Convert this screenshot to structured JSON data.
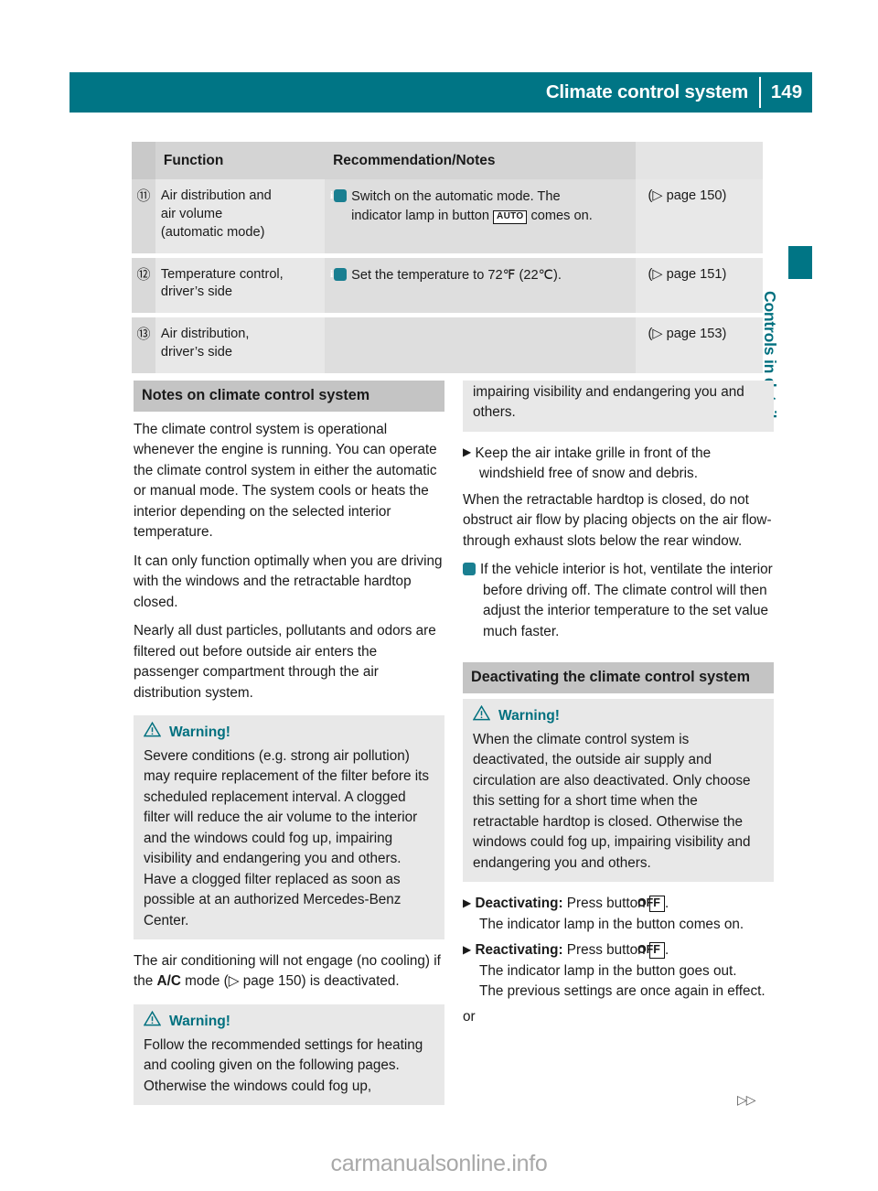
{
  "header": {
    "title": "Climate control system",
    "page_number": "149"
  },
  "side_tab": {
    "label": "Controls in detail"
  },
  "table": {
    "columns": [
      "Function",
      "Recommendation/Notes",
      ""
    ],
    "rows": [
      {
        "num": "⑪",
        "function_lines": [
          "Air distribution and",
          "air volume",
          "(automatic mode)"
        ],
        "note_lines": [
          "Switch on the automatic mode. The",
          "indicator lamp in button",
          "comes on."
        ],
        "note_button": "AUTO",
        "reference": "(▷ page 150)"
      },
      {
        "num": "⑫",
        "function_lines": [
          "Temperature control,",
          "driver’s side"
        ],
        "note_lines": [
          "Set the temperature to 72℉ (22℃)."
        ],
        "note_button": "",
        "reference": "(▷ page 151)"
      },
      {
        "num": "⑬",
        "function_lines": [
          "Air distribution,",
          "driver’s side"
        ],
        "note_lines": [],
        "note_button": "",
        "reference": "(▷ page 153)"
      }
    ]
  },
  "left_column": {
    "section_heading": "Notes on climate control system",
    "para1": "The climate control system is operational whenever the engine is running. You can operate the climate control system in either the automatic or manual mode. The system cools or heats the interior depending on the selected interior temperature.",
    "para2": "It can only function optimally when you are driving with the windows and the retractable hardtop closed.",
    "para3": "Nearly all dust particles, pollutants and odors are filtered out before outside air enters the passenger compartment through the air distribution system.",
    "warning1": {
      "title": "Warning!",
      "body": "Severe conditions (e.g. strong air pollution) may require replacement of the filter before its scheduled replacement interval. A clogged filter will reduce the air volume to the interior and the windows could fog up, impairing visibility and endangering you and others. Have a clogged filter replaced as soon as possible at an authorized Mercedes-Benz Center."
    },
    "para4_pre": "The air conditioning will not engage (no cooling) if the ",
    "para4_bold": "A/C",
    "para4_mid": " mode (▷ page 150) is deactivated.",
    "warning2": {
      "title": "Warning!",
      "body": "Follow the recommended settings for heating and cooling given on the following pages. Otherwise the windows could fog up,"
    }
  },
  "right_column": {
    "warning2_cont": "impairing visibility and endangering you and others.",
    "bullet1": "Keep the air intake grille in front of the windshield free of snow and debris.",
    "para1": "When the retractable hardtop is closed, do not obstruct air flow by placing objects on the air flow-through exhaust slots below the rear window.",
    "info1": "If the vehicle interior is hot, ventilate the interior before driving off. The climate control will then adjust the interior temperature to the set value much faster.",
    "section_heading": "Deactivating the climate control system",
    "warning3": {
      "title": "Warning!",
      "body": "When the climate control system is deactivated, the outside air supply and circulation are also deactivated. Only choose this setting for a short time when the retractable hardtop is closed. Otherwise the windows could fog up, impairing visibility and endangering you and others."
    },
    "step1_label": "Deactivating:",
    "step1_text_pre": " Press button ",
    "step1_button": "OFF",
    "step1_text_post": ".",
    "step1_result": "The indicator lamp in the button comes on.",
    "step2_label": "Reactivating:",
    "step2_text_pre": " Press button ",
    "step2_button": "OFF",
    "step2_text_post": ".",
    "step2_result_line1": "The indicator lamp in the button goes out.",
    "step2_result_line2": "The previous settings are once again in effect.",
    "or_text": "or"
  },
  "footer": {
    "next_page_arrow": "▷▷",
    "watermark": "carmanualsonline.info"
  },
  "colors": {
    "brand_teal": "#007585",
    "tab_teal": "#00707f",
    "band_gray": "#c4c4c4",
    "box_gray": "#e8e8e8",
    "info_icon": "#1a7f91"
  }
}
